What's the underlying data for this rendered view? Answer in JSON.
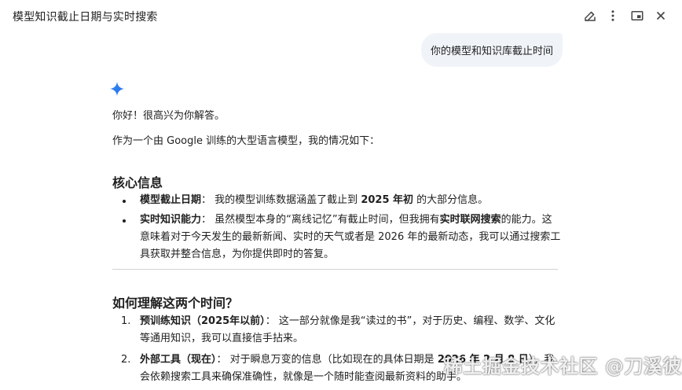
{
  "window": {
    "title": "模型知识截止日期与实时搜索",
    "icons": [
      "edit-icon",
      "more-vert-icon",
      "open-in-window-icon",
      "close-icon"
    ]
  },
  "conversation": {
    "user_message": "你的模型和知识库截止时间",
    "assistant": {
      "greeting": "你好！很高兴为你解答。",
      "intro": "作为一个由 Google 训练的大型语言模型，我的情况如下：",
      "section1": {
        "heading": "核心信息",
        "items": [
          {
            "label": "模型截止日期",
            "sep": "：",
            "text_a": "我的模型训练数据涵盖了截止到 ",
            "bold_mid": "2025 年初",
            "text_b": " 的大部分信息。"
          },
          {
            "label": "实时知识能力",
            "sep": "：",
            "text_a": "虽然模型本身的“离线记忆”有截止时间，但我拥有",
            "bold_mid": "实时联网搜索",
            "text_b": "的能力。这意味着对于今天发生的最新新闻、实时的天气或者是 2026 年的最新动态，我可以通过搜索工具获取并整合信息，为你提供即时的答复。"
          }
        ]
      },
      "section2": {
        "heading": "如何理解这两个时间？",
        "items": [
          {
            "num": "1.",
            "label": "预训练知识（2025年以前）",
            "sep": "：",
            "text": "这一部分就像是我“读过的书”，对于历史、编程、数学、文化等通用知识，我可以直接信手拈来。"
          },
          {
            "num": "2.",
            "label": "外部工具（现在）",
            "sep": "：",
            "text_a": "对于瞬息万变的信息（比如现在的具体日期是 ",
            "bold_mid": "2026 年 2 月 8 日",
            "text_b": "），我会依赖搜索工具来确保准确性，就像是一个随时能查阅最新资料的助手。"
          }
        ]
      }
    }
  },
  "watermark": "稀土掘金技术社区 @刀溪彼岸",
  "colors": {
    "user_bubble": "#f0f4f9",
    "spark_blue": "#4285f4",
    "text": "#1f1f1f"
  }
}
